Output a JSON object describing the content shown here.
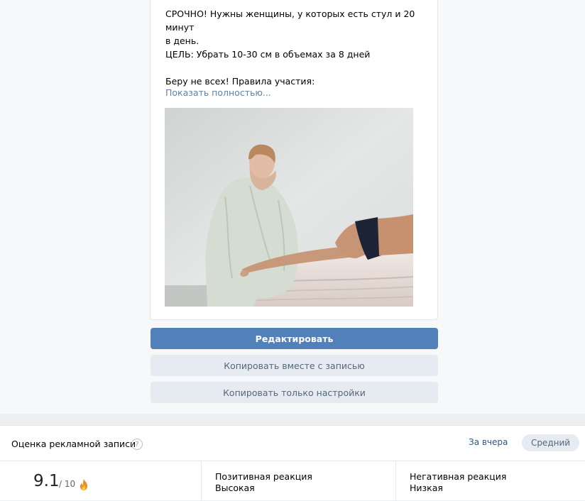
{
  "post": {
    "line1": "СРОЧНО! Нужны женщины, у которых есть стул и 20 минут",
    "line2": "в день.",
    "line3": "ЦЕЛЬ: Убрать 10-30 см в объемах за 8 дней",
    "line4": "Беру не всех! Правила участия:",
    "show_more": "Показать полностью..."
  },
  "actions": {
    "edit": "Редактировать",
    "copy_with_post": "Копировать вместе с записью",
    "copy_settings": "Копировать только настройки"
  },
  "rating": {
    "title": "Оценка рекламной записи",
    "help": "?",
    "period_link": "За вчера",
    "period_chip": "Средний",
    "score": "9.1",
    "score_max": "/ 10",
    "positive_label": "Позитивная реакция",
    "positive_value": "Высокая",
    "negative_label": "Негативная реакция",
    "negative_value": "Низкая"
  },
  "colors": {
    "accent": "#5181b8",
    "link": "#2a5885",
    "secondary_button": "#e5ebf1"
  }
}
